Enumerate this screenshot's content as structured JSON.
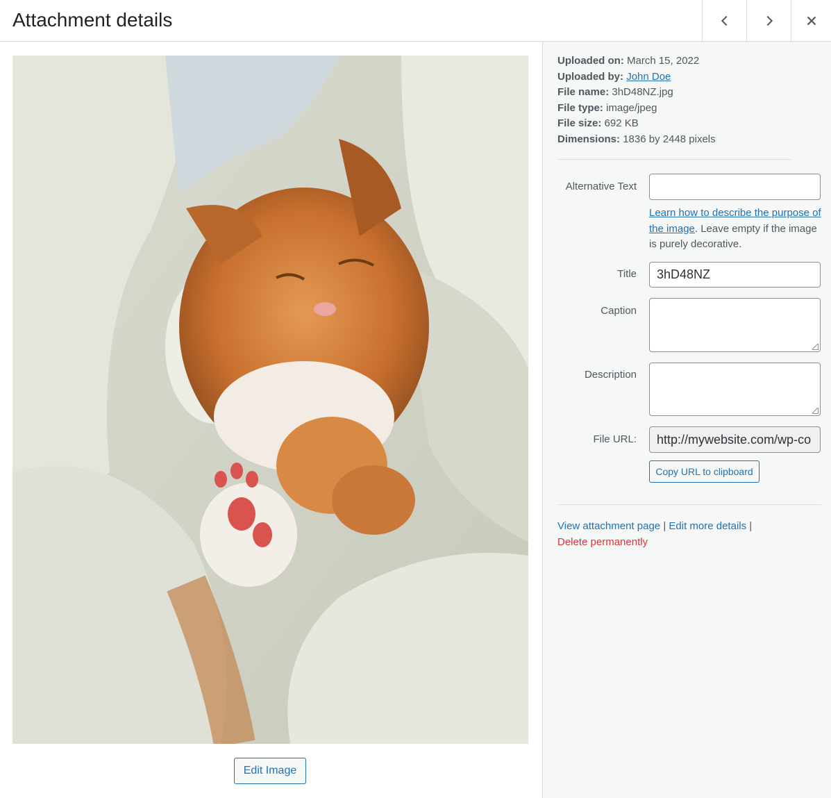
{
  "header": {
    "title": "Attachment details",
    "prev_icon": "chevron-left-icon",
    "next_icon": "chevron-right-icon",
    "close_icon": "close-icon"
  },
  "preview": {
    "edit_image_label": "Edit Image"
  },
  "details": {
    "uploaded_on_label": "Uploaded on:",
    "uploaded_on": "March 15, 2022",
    "uploaded_by_label": "Uploaded by:",
    "uploaded_by": "John Doe",
    "file_name_label": "File name:",
    "file_name": "3hD48NZ.jpg",
    "file_type_label": "File type:",
    "file_type": "image/jpeg",
    "file_size_label": "File size:",
    "file_size": "692 KB",
    "dimensions_label": "Dimensions:",
    "dimensions": "1836 by 2448 pixels"
  },
  "form": {
    "alt_label": "Alternative Text",
    "alt_value": "",
    "alt_help_link": "Learn how to describe the purpose of the image",
    "alt_help_text": ". Leave empty if the image is purely decorative.",
    "title_label": "Title",
    "title_value": "3hD48NZ",
    "caption_label": "Caption",
    "caption_value": "",
    "description_label": "Description",
    "description_value": "",
    "file_url_label": "File URL:",
    "file_url_value": "http://mywebsite.com/wp-co",
    "copy_label": "Copy URL to clipboard"
  },
  "actions": {
    "view": "View attachment page",
    "sep1": " | ",
    "edit": "Edit more details",
    "sep2": " |",
    "delete": "Delete permanently"
  },
  "colors": {
    "accent": "#2271b1",
    "danger": "#d63638",
    "panel_bg": "#f6f7f7"
  }
}
